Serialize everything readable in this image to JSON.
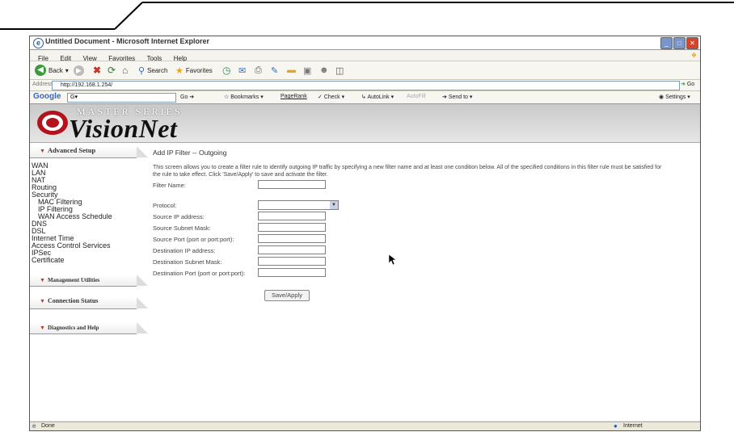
{
  "window": {
    "title": "Untitled Document - Microsoft Internet Explorer"
  },
  "menu": [
    "File",
    "Edit",
    "View",
    "Favorites",
    "Tools",
    "Help"
  ],
  "toolbar": {
    "back": "Back",
    "search": "Search",
    "favorites": "Favorites"
  },
  "address": {
    "label": "Address",
    "url": "http://192.168.1.254/",
    "go": "Go"
  },
  "googlebar": {
    "logo": "Google",
    "search_prefix": "G",
    "go": "Go",
    "bookmarks": "Bookmarks",
    "pagerank": "PageRank",
    "check": "Check",
    "autolink": "AutoLink",
    "autofill": "AutoFill",
    "send": "Send to",
    "settings": "Settings"
  },
  "brand": {
    "series": "MASTER SERIES",
    "name": "VisionNet"
  },
  "sidebar": {
    "advanced_setup": "Advanced Setup",
    "items": [
      "WAN",
      "LAN",
      "NAT",
      "Routing",
      "Security",
      "MAC Filtering",
      "IP Filtering",
      "WAN Access Schedule",
      "DNS",
      "DSL",
      "Internet Time",
      "Access Control Services",
      "IPSec",
      "Certificate"
    ],
    "management": "Management Utilities",
    "connection": "Connection Status",
    "diagnostics": "Diagnostics and Help"
  },
  "page": {
    "title": "Add IP Filter -- Outgoing",
    "description": "This screen allows you to create a filter rule to identify outgoing IP traffic by specifying a new filter name and at least one condition below. All of the specified conditions in this filter rule must be satisfied for the rule to take effect. Click 'Save/Apply' to save and activate the filter.",
    "fields": {
      "filter_name": "Filter Name:",
      "protocol": "Protocol:",
      "src_ip": "Source IP address:",
      "src_mask": "Source Subnet Mask:",
      "src_port": "Source Port (port or port:port):",
      "dst_ip": "Destination IP address:",
      "dst_mask": "Destination Subnet Mask:",
      "dst_port": "Destination Port (port or port:port):"
    },
    "save_label": "Save/Apply"
  },
  "status": {
    "text": "Done",
    "zone": "Internet"
  },
  "colors": {
    "accent": "#c0392b",
    "logo_red": "#b3131b"
  }
}
